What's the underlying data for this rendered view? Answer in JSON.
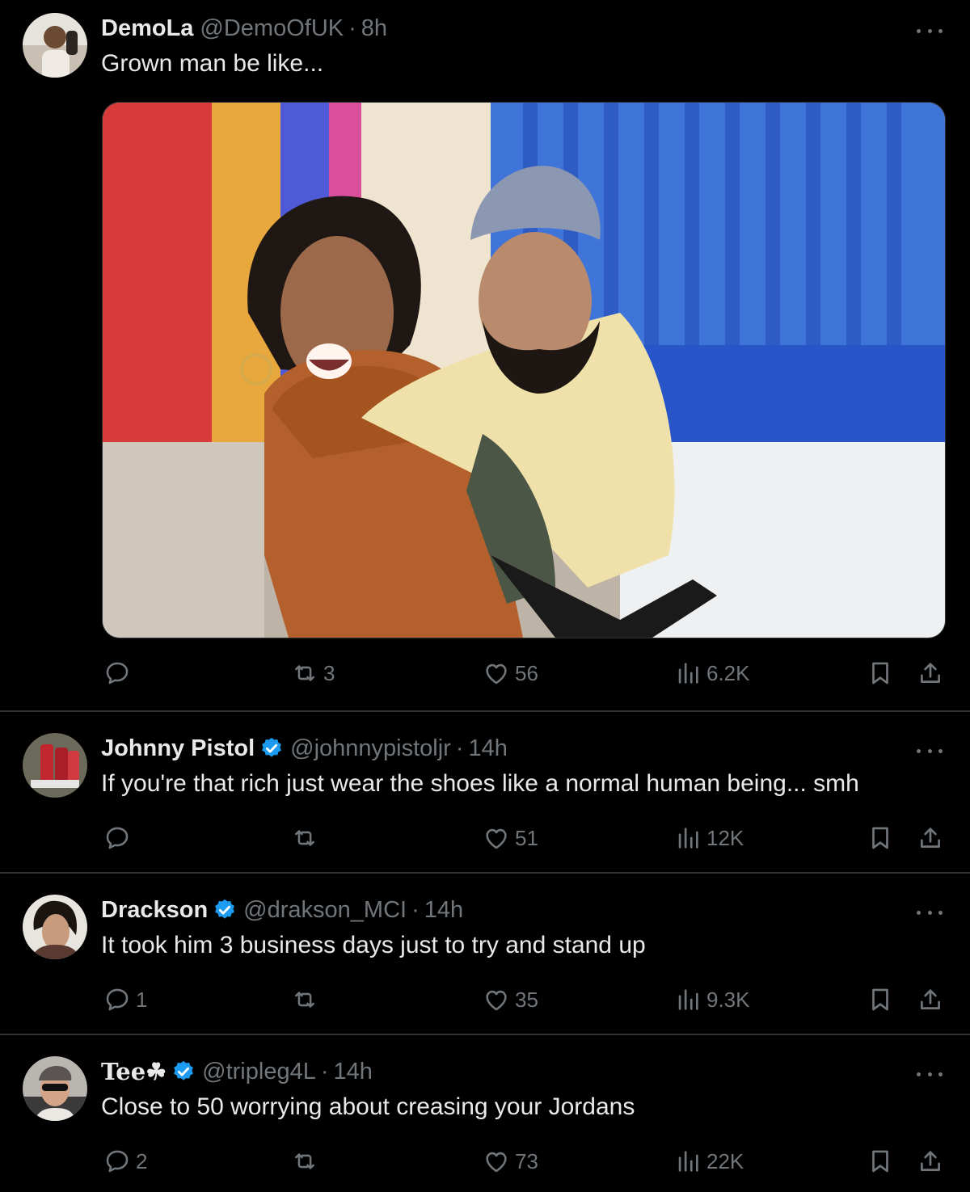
{
  "tweets": [
    {
      "name": "DemoLa",
      "handle": "@DemoOfUK",
      "separator": "·",
      "time": "8h",
      "verified": false,
      "text": "Grown man be like...",
      "replies": "",
      "retweets": "3",
      "likes": "56",
      "views": "6.2K",
      "has_media": true
    },
    {
      "name": "Johnny Pistol",
      "handle": "@johnnypistoljr",
      "separator": "·",
      "time": "14h",
      "verified": true,
      "text": "If you're that rich just wear the shoes like a normal human being... smh",
      "replies": "",
      "retweets": "",
      "likes": "51",
      "views": "12K"
    },
    {
      "name": "Drackson",
      "handle": "@drakson_MCI",
      "separator": "·",
      "time": "14h",
      "verified": true,
      "text": "It took him 3 business days just to try and stand up",
      "replies": "1",
      "retweets": "",
      "likes": "35",
      "views": "9.3K"
    },
    {
      "name": "Tee☘",
      "handle": "@tripleg4L",
      "separator": "·",
      "time": "14h",
      "verified": true,
      "text": "Close to 50 worrying about creasing your Jordans",
      "replies": "2",
      "retweets": "",
      "likes": "73",
      "views": "22K"
    }
  ],
  "colors": {
    "background": "#000000",
    "text": "#e7e9ea",
    "muted": "#71767b",
    "divider": "#2f3336",
    "verified": "#1d9bf0"
  },
  "icons": {
    "reply": "reply-icon",
    "retweet": "retweet-icon",
    "like": "heart-icon",
    "views": "views-icon",
    "bookmark": "bookmark-icon",
    "share": "share-icon",
    "more": "more-icon",
    "verified": "verified-badge-icon"
  }
}
